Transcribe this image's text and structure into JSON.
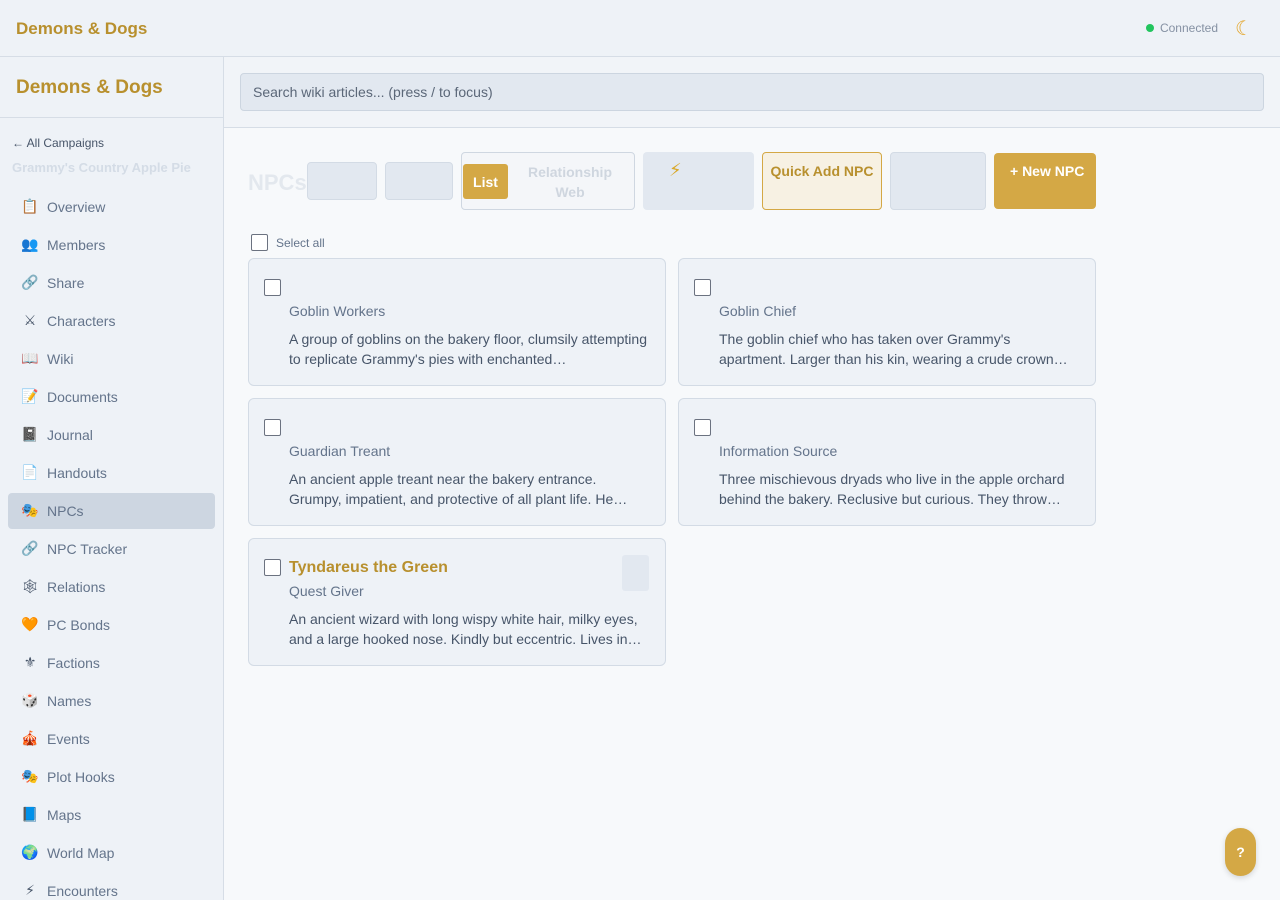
{
  "app": {
    "title": "Demons & Dogs"
  },
  "topbar": {
    "status": "Connected",
    "theme_icon": "moon-icon"
  },
  "sidebar": {
    "title": "Demons & Dogs",
    "back_link": "← All Campaigns",
    "campaign": "Grammy's Country Apple Pie",
    "items": [
      {
        "label": "Overview",
        "icon": "📋"
      },
      {
        "label": "Members",
        "icon": "👥"
      },
      {
        "label": "Share",
        "icon": "🔗"
      },
      {
        "label": "Characters",
        "icon": "⚔"
      },
      {
        "label": "Wiki",
        "icon": "📖"
      },
      {
        "label": "Documents",
        "icon": "📝"
      },
      {
        "label": "Journal",
        "icon": "📓"
      },
      {
        "label": "Handouts",
        "icon": "📄"
      },
      {
        "label": "NPCs",
        "icon": "🎭"
      },
      {
        "label": "NPC Tracker",
        "icon": "🔗"
      },
      {
        "label": "Relations",
        "icon": "🕸"
      },
      {
        "label": "PC Bonds",
        "icon": "🧡"
      },
      {
        "label": "Factions",
        "icon": "⚜"
      },
      {
        "label": "Names",
        "icon": "🎲"
      },
      {
        "label": "Events",
        "icon": "🎪"
      },
      {
        "label": "Plot Hooks",
        "icon": "🎭"
      },
      {
        "label": "Maps",
        "icon": "📘"
      },
      {
        "label": "World Map",
        "icon": "🌍"
      },
      {
        "label": "Encounters",
        "icon": "⚡"
      }
    ]
  },
  "search": {
    "placeholder": "Search wiki articles... (press / to focus)"
  },
  "toolbar": {
    "title": "NPCs",
    "view_list": "List",
    "view_web": "Relationship Web",
    "bolt_icon": "⚡",
    "quick_add": "Quick Add NPC",
    "new_npc": "+ New NPC"
  },
  "select_all": "Select all",
  "npcs": [
    {
      "name": "",
      "role": "Goblin Workers",
      "desc": "A group of goblins on the bakery floor, clumsily attempting to replicate Grammy's pies with enchanted…"
    },
    {
      "name": "",
      "role": "Goblin Chief",
      "desc": "The goblin chief who has taken over Grammy's apartment. Larger than his kin, wearing a crude crown made from a…"
    },
    {
      "name": "",
      "role": "Guardian Treant",
      "desc": "An ancient apple treant near the bakery entrance. Grumpy, impatient, and protective of all plant life. He…"
    },
    {
      "name": "",
      "role": "Information Source",
      "desc": "Three mischievous dryads who live in the apple orchard behind the bakery. Reclusive but curious. They throw…"
    },
    {
      "name": "Tyndareus the Green",
      "role": "Quest Giver",
      "desc": "An ancient wizard with long wispy white hair, milky eyes, and a large hooked nose. Kindly but eccentric. Lives in a…"
    }
  ],
  "help": "?"
}
